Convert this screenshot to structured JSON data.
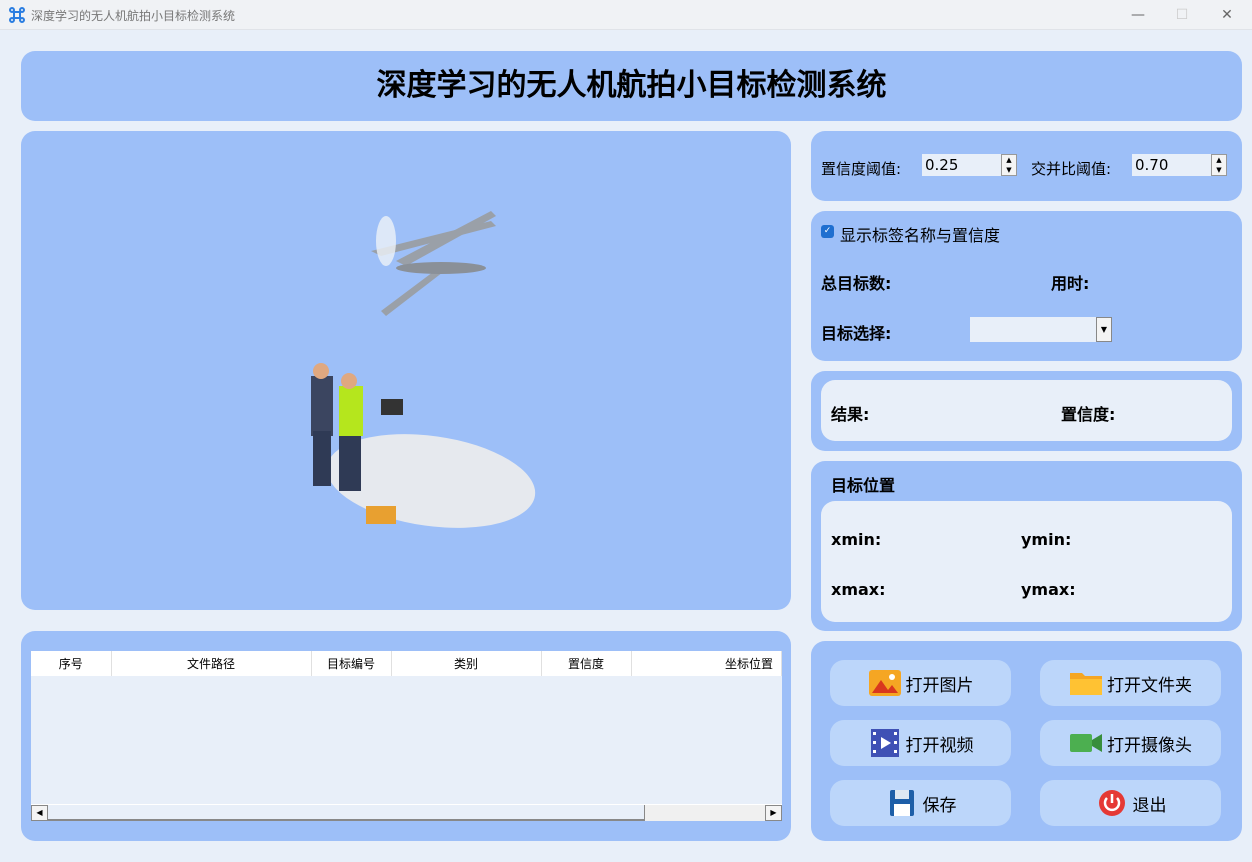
{
  "window": {
    "title": "深度学习的无人机航拍小目标检测系统",
    "minimize": "—",
    "maximize": "☐",
    "close": "✕"
  },
  "header": {
    "title": "深度学习的无人机航拍小目标检测系统"
  },
  "params": {
    "conf_label": "置信度阈值:",
    "conf_value": "0.25",
    "iou_label": "交并比阈值:",
    "iou_value": "0.70"
  },
  "info": {
    "show_label_text": "显示标签名称与置信度",
    "show_label_checked": true,
    "total_label": "总目标数:",
    "time_label": "用时:",
    "select_label": "目标选择:",
    "select_value": ""
  },
  "result": {
    "result_label": "结果:",
    "conf_label": "置信度:"
  },
  "position": {
    "title": "目标位置",
    "xmin": "xmin:",
    "ymin": "ymin:",
    "xmax": "xmax:",
    "ymax": "ymax:"
  },
  "buttons": {
    "open_image": "打开图片",
    "open_folder": "打开文件夹",
    "open_video": "打开视频",
    "open_camera": "打开摄像头",
    "save": "保存",
    "exit": "退出"
  },
  "table": {
    "columns": [
      "序号",
      "文件路径",
      "目标编号",
      "类别",
      "置信度",
      "坐标位置"
    ],
    "rows": []
  }
}
